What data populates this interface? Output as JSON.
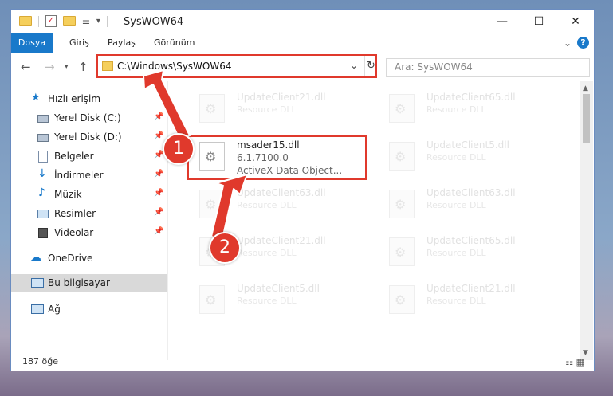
{
  "window": {
    "title": "SysWOW64",
    "controls": {
      "minimize": "—",
      "maximize": "☐",
      "close": "✕"
    }
  },
  "ribbon": {
    "file_tab": "Dosya",
    "tabs": [
      "Giriş",
      "Paylaş",
      "Görünüm"
    ],
    "help": "?"
  },
  "address": {
    "path": "C:\\Windows\\SysWOW64",
    "search_placeholder": "Ara: SysWOW64"
  },
  "sidebar": {
    "items": [
      {
        "label": "Hızlı erişim",
        "icon": "star-icon",
        "pinned": false
      },
      {
        "label": "Yerel Disk (C:)",
        "icon": "drive-icon",
        "pinned": true
      },
      {
        "label": "Yerel Disk (D:)",
        "icon": "drive-icon",
        "pinned": true
      },
      {
        "label": "Belgeler",
        "icon": "documents-icon",
        "pinned": true
      },
      {
        "label": "İndirmeler",
        "icon": "download-icon",
        "pinned": true
      },
      {
        "label": "Müzik",
        "icon": "music-icon",
        "pinned": true
      },
      {
        "label": "Resimler",
        "icon": "pictures-icon",
        "pinned": true
      },
      {
        "label": "Videolar",
        "icon": "videos-icon",
        "pinned": true
      },
      {
        "label": "OneDrive",
        "icon": "cloud-icon",
        "pinned": false
      },
      {
        "label": "Bu bilgisayar",
        "icon": "computer-icon",
        "pinned": false
      },
      {
        "label": "Ağ",
        "icon": "network-icon",
        "pinned": false
      }
    ]
  },
  "files": {
    "highlighted": {
      "name": "msader15.dll",
      "version": "6.1.7100.0",
      "desc": "ActiveX Data Object..."
    },
    "others": [
      {
        "name": "UpdateClient21.dll",
        "sub": "Resource DLL"
      },
      {
        "name": "UpdateClient65.dll",
        "sub": "Resource DLL"
      },
      {
        "name": "UpdateClient5.dll",
        "sub": "Resource DLL"
      },
      {
        "name": "UpdateClient63.dll",
        "sub": "Resource DLL"
      },
      {
        "name": "UpdateClient63.dll",
        "sub": "Resource DLL"
      },
      {
        "name": "UpdateClient21.dll",
        "sub": "Resource DLL"
      },
      {
        "name": "UpdateClient65.dll",
        "sub": "Resource DLL"
      },
      {
        "name": "UpdateClient5.dll",
        "sub": "Resource DLL"
      },
      {
        "name": "UpdateClient21.dll",
        "sub": "Resource DLL"
      }
    ]
  },
  "status": {
    "count": "187 öğe"
  },
  "annotations": {
    "step1": "1",
    "step2": "2"
  },
  "colors": {
    "accent": "#1979ca",
    "highlight": "#e0392c"
  }
}
